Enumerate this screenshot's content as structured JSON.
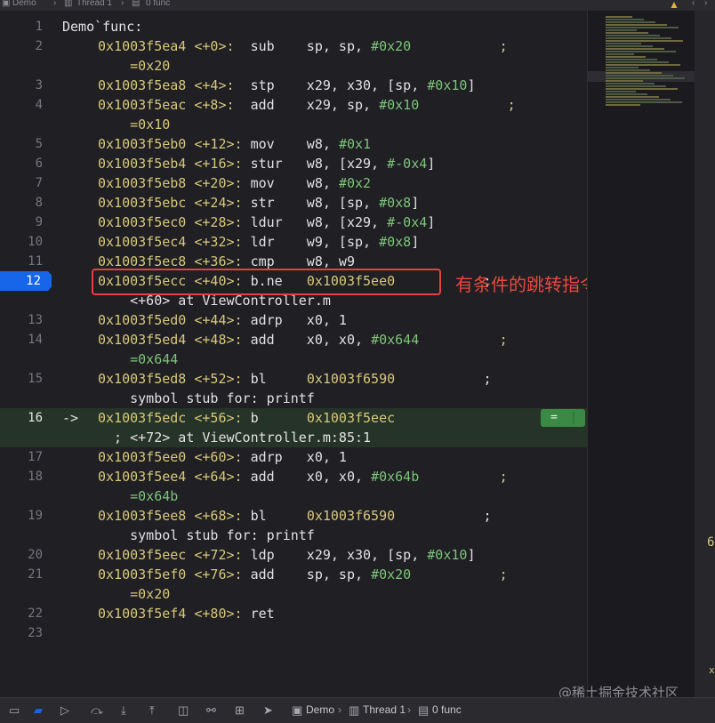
{
  "breadcrumb": {
    "project": "Demo",
    "thread": "Thread 1",
    "frame": "0 func"
  },
  "colors": {
    "accent": "#1766ea",
    "highlight_box": "#e8403e",
    "annotation": "#e84a3e",
    "current_line_bg": "#263328"
  },
  "code": {
    "header": "Demo`func:",
    "lines": [
      {
        "ln": "1",
        "segs": [
          [
            "w",
            "Demo`func:"
          ]
        ]
      },
      {
        "ln": "2",
        "segs": [
          [
            "y",
            "0x1003f5ea4 <+0>:  "
          ],
          [
            "w",
            "sub    sp, sp, "
          ],
          [
            "g",
            "#0x20"
          ],
          [
            "w",
            "           "
          ],
          [
            "y",
            ";"
          ]
        ]
      },
      {
        "ln": "",
        "segs": [
          [
            "w",
            "    "
          ],
          [
            "y",
            "=0x20"
          ]
        ]
      },
      {
        "ln": "3",
        "segs": [
          [
            "y",
            "0x1003f5ea8 <+4>:  "
          ],
          [
            "w",
            "stp    x29, x30, [sp, "
          ],
          [
            "g",
            "#0x10"
          ],
          [
            "w",
            "]"
          ]
        ]
      },
      {
        "ln": "4",
        "segs": [
          [
            "y",
            "0x1003f5eac <+8>:  "
          ],
          [
            "w",
            "add    x29, sp, "
          ],
          [
            "g",
            "#0x10"
          ],
          [
            "w",
            "           "
          ],
          [
            "y",
            ";"
          ]
        ]
      },
      {
        "ln": "",
        "segs": [
          [
            "w",
            "    "
          ],
          [
            "y",
            "=0x10"
          ]
        ]
      },
      {
        "ln": "5",
        "segs": [
          [
            "y",
            "0x1003f5eb0 <+12>: "
          ],
          [
            "w",
            "mov    w8, "
          ],
          [
            "g",
            "#0x1"
          ]
        ]
      },
      {
        "ln": "6",
        "segs": [
          [
            "y",
            "0x1003f5eb4 <+16>: "
          ],
          [
            "w",
            "stur   w8, [x29, "
          ],
          [
            "g",
            "#-0x4"
          ],
          [
            "w",
            "]"
          ]
        ]
      },
      {
        "ln": "7",
        "segs": [
          [
            "y",
            "0x1003f5eb8 <+20>: "
          ],
          [
            "w",
            "mov    w8, "
          ],
          [
            "g",
            "#0x2"
          ]
        ]
      },
      {
        "ln": "8",
        "segs": [
          [
            "y",
            "0x1003f5ebc <+24>: "
          ],
          [
            "w",
            "str    w8, [sp, "
          ],
          [
            "g",
            "#0x8"
          ],
          [
            "w",
            "]"
          ]
        ]
      },
      {
        "ln": "9",
        "segs": [
          [
            "y",
            "0x1003f5ec0 <+28>: "
          ],
          [
            "w",
            "ldur   w8, [x29, "
          ],
          [
            "g",
            "#-0x4"
          ],
          [
            "w",
            "]"
          ]
        ]
      },
      {
        "ln": "10",
        "segs": [
          [
            "y",
            "0x1003f5ec4 <+32>: "
          ],
          [
            "w",
            "ldr    w9, [sp, "
          ],
          [
            "g",
            "#0x8"
          ],
          [
            "w",
            "]"
          ]
        ]
      },
      {
        "ln": "11",
        "segs": [
          [
            "y",
            "0x1003f5ec8 <+36>: "
          ],
          [
            "w",
            "cmp    w8, w9"
          ]
        ]
      },
      {
        "ln": "12",
        "pc": true,
        "segs": [
          [
            "y",
            "0x1003f5ecc <+40>: "
          ],
          [
            "w",
            "b.ne   "
          ],
          [
            "y",
            "0x1003f5ee0"
          ],
          [
            "w",
            "           ;"
          ]
        ]
      },
      {
        "ln": "",
        "segs": [
          [
            "w",
            "    <+60> at ViewController.m"
          ]
        ]
      },
      {
        "ln": "13",
        "segs": [
          [
            "y",
            "0x1003f5ed0 <+44>: "
          ],
          [
            "w",
            "adrp   x0, 1"
          ]
        ]
      },
      {
        "ln": "14",
        "segs": [
          [
            "y",
            "0x1003f5ed4 <+48>: "
          ],
          [
            "w",
            "add    x0, x0, "
          ],
          [
            "g",
            "#0x644"
          ],
          [
            "w",
            "          "
          ],
          [
            "y",
            ";"
          ]
        ]
      },
      {
        "ln": "",
        "segs": [
          [
            "w",
            "    "
          ],
          [
            "g",
            "=0x644"
          ]
        ]
      },
      {
        "ln": "15",
        "segs": [
          [
            "y",
            "0x1003f5ed8 <+52>: "
          ],
          [
            "w",
            "bl     "
          ],
          [
            "y",
            "0x1003f6590"
          ],
          [
            "w",
            "           ;"
          ]
        ]
      },
      {
        "ln": "",
        "segs": [
          [
            "w",
            "    symbol stub for: printf"
          ]
        ]
      },
      {
        "ln": "16",
        "current": true,
        "arrow": "->",
        "segs": [
          [
            "y",
            "0x1003f5edc <+56>: "
          ],
          [
            "w",
            "b      "
          ],
          [
            "y",
            "0x1003f5eec"
          ]
        ]
      },
      {
        "ln": "",
        "current": true,
        "segs": [
          [
            "w",
            "  ; <+72> at ViewController.m:85:1"
          ]
        ]
      },
      {
        "ln": "17",
        "segs": [
          [
            "y",
            "0x1003f5ee0 <+60>: "
          ],
          [
            "w",
            "adrp   x0, 1"
          ]
        ]
      },
      {
        "ln": "18",
        "segs": [
          [
            "y",
            "0x1003f5ee4 <+64>: "
          ],
          [
            "w",
            "add    x0, x0, "
          ],
          [
            "g",
            "#0x64b"
          ],
          [
            "w",
            "          "
          ],
          [
            "y",
            ";"
          ]
        ]
      },
      {
        "ln": "",
        "segs": [
          [
            "w",
            "    "
          ],
          [
            "g",
            "=0x64b"
          ]
        ]
      },
      {
        "ln": "19",
        "segs": [
          [
            "y",
            "0x1003f5ee8 <+68>: "
          ],
          [
            "w",
            "bl     "
          ],
          [
            "y",
            "0x1003f6590"
          ],
          [
            "w",
            "           ;"
          ]
        ]
      },
      {
        "ln": "",
        "segs": [
          [
            "w",
            "    symbol stub for: printf"
          ]
        ]
      },
      {
        "ln": "20",
        "segs": [
          [
            "y",
            "0x1003f5eec <+72>: "
          ],
          [
            "w",
            "ldp    x29, x30, [sp, "
          ],
          [
            "g",
            "#0x10"
          ],
          [
            "w",
            "]"
          ]
        ]
      },
      {
        "ln": "21",
        "segs": [
          [
            "y",
            "0x1003f5ef0 <+76>: "
          ],
          [
            "w",
            "add    sp, sp, "
          ],
          [
            "g",
            "#0x20"
          ],
          [
            "w",
            "           "
          ],
          [
            "y",
            ";"
          ]
        ]
      },
      {
        "ln": "",
        "segs": [
          [
            "w",
            "    "
          ],
          [
            "y",
            "=0x20"
          ]
        ]
      },
      {
        "ln": "22",
        "segs": [
          [
            "y",
            "0x1003f5ef4 <+80>: "
          ],
          [
            "w",
            "ret"
          ]
        ]
      },
      {
        "ln": "23",
        "segs": []
      }
    ]
  },
  "annotation_text": "有条件的跳转指令",
  "current_line_button": "=",
  "bottom_icons": [
    "sidebar-icon",
    "breakpoint-icon",
    "continue-icon",
    "step-over-icon",
    "step-into-icon",
    "step-out-icon",
    "view-hierarchy-icon",
    "memory-graph-icon",
    "environment-icon",
    "location-icon"
  ],
  "watermark": "@稀土掘金技术社区",
  "stray_text": "6",
  "stray_x": "x"
}
